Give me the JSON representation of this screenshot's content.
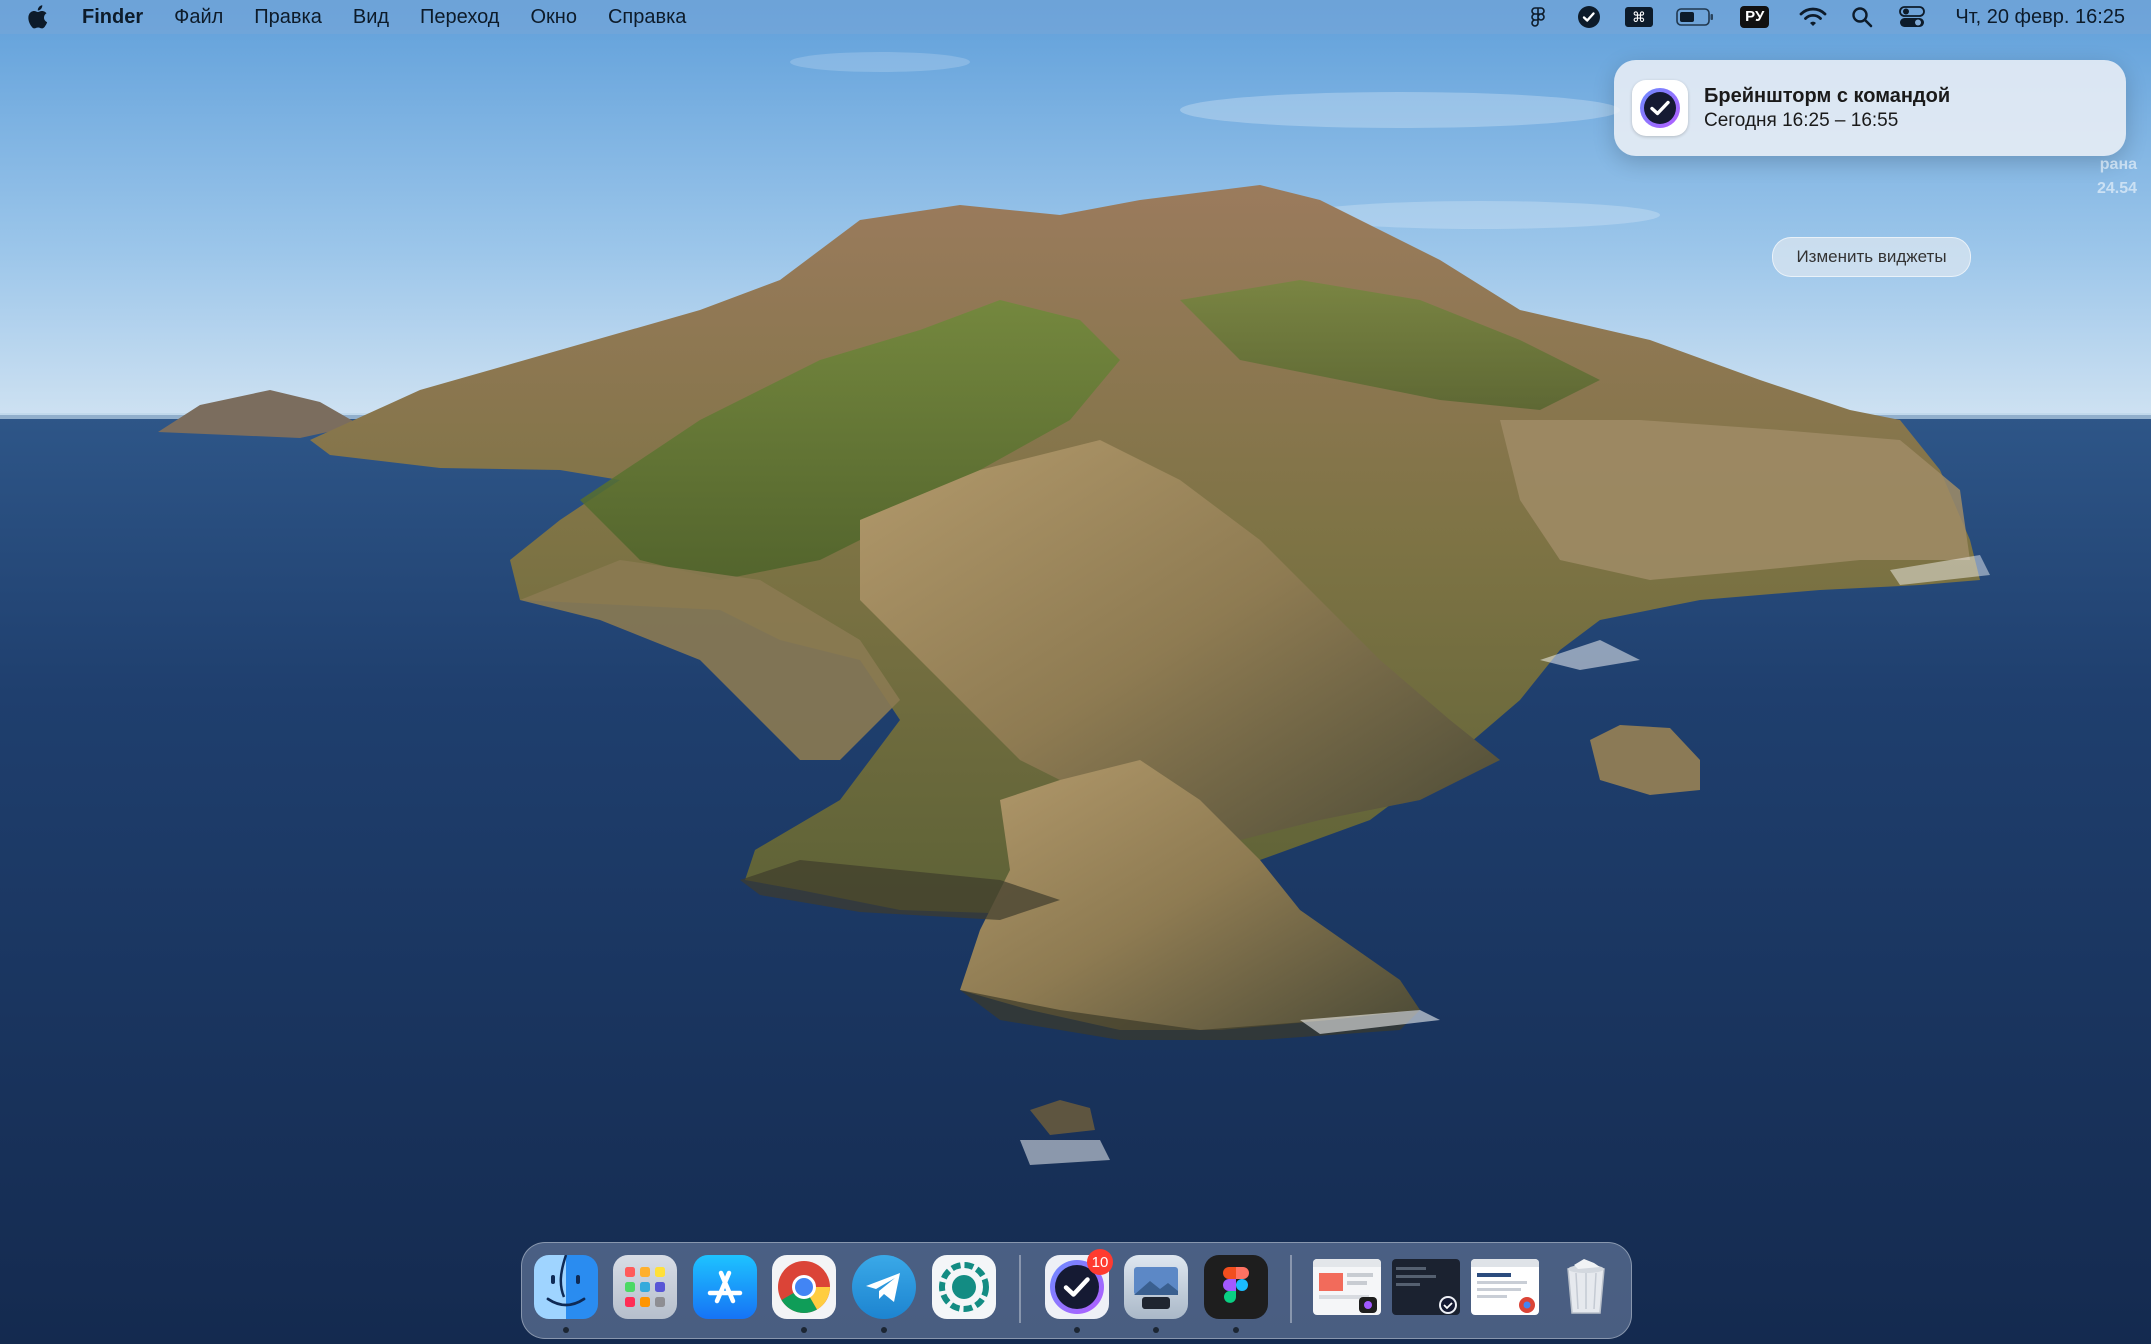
{
  "menubar": {
    "apple_icon": "apple-logo-icon",
    "app_name": "Finder",
    "items": [
      "Файл",
      "Правка",
      "Вид",
      "Переход",
      "Окно",
      "Справка"
    ],
    "status_icons": [
      "figma-icon",
      "task-check-icon",
      "keyboard-command-icon",
      "battery-icon",
      "input-language-icon",
      "wifi-icon",
      "spotlight-search-icon",
      "control-center-icon"
    ],
    "language": "РУ",
    "clock": "Чт, 20 февр.  16:25"
  },
  "notification": {
    "title": "Брейншторм с командой",
    "subtitle": "Сегодня 16:25 – 16:55",
    "behind_text_1": "рана",
    "behind_text_2": "24.54"
  },
  "widgets": {
    "edit_label": "Изменить виджеты"
  },
  "dock": {
    "apps": [
      "finder-icon",
      "launchpad-icon",
      "app-store-icon",
      "chrome-icon",
      "telegram-icon",
      "screen-recorder-icon",
      "tasks-app-icon",
      "preview-icon",
      "figma-app-icon"
    ],
    "badge_count": "10",
    "recent": [
      "figma-window-thumbnail",
      "tasks-window-thumbnail",
      "chrome-window-thumbnail"
    ],
    "trash": "trash-icon"
  },
  "colors": {
    "sky": "#8fc0ea",
    "sea": "#1d3d6b",
    "badge": "#ff3b30"
  }
}
